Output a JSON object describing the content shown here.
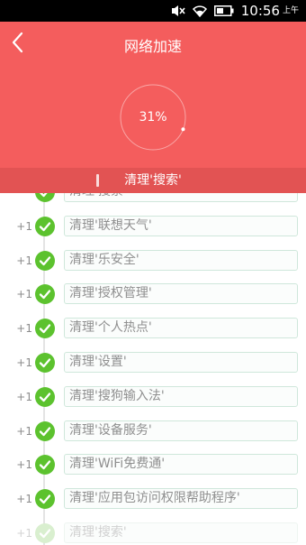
{
  "status_bar": {
    "time": "10:56",
    "ampm": "上午"
  },
  "header": {
    "title": "网络加速",
    "progress_text": "31%",
    "progress": 0.31
  },
  "current_task": "清理'搜索'",
  "tasks": [
    {
      "count": "",
      "label": "清理'搜索'"
    },
    {
      "count": "+1",
      "label": "清理'联想天气'"
    },
    {
      "count": "+1",
      "label": "清理'乐安全'"
    },
    {
      "count": "+1",
      "label": "清理'授权管理'"
    },
    {
      "count": "+1",
      "label": "清理'个人热点'"
    },
    {
      "count": "+1",
      "label": "清理'设置'"
    },
    {
      "count": "+1",
      "label": "清理'搜狗输入法'"
    },
    {
      "count": "+1",
      "label": "清理'设备服务'"
    },
    {
      "count": "+1",
      "label": "清理'WiFi免费通'"
    },
    {
      "count": "+1",
      "label": "清理'应用包访问权限帮助程序'"
    },
    {
      "count": "+1",
      "label": "清理'搜索'"
    }
  ],
  "colors": {
    "header": "#f45d5d",
    "banner": "#e25353",
    "check": "#5cc22e"
  },
  "icons": {
    "back": "chevron-left-icon",
    "check": "check-icon",
    "wifi": "wifi-icon",
    "battery": "battery-icon"
  }
}
